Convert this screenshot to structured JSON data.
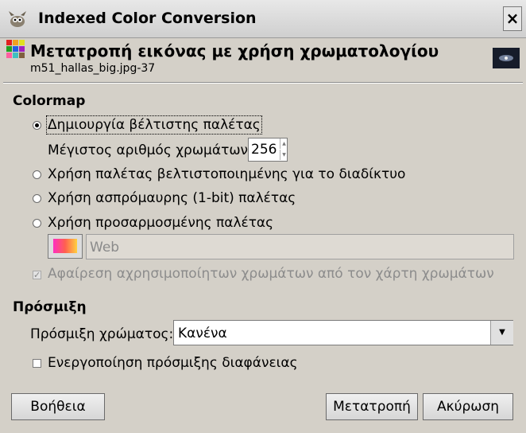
{
  "window": {
    "title": "Indexed Color Conversion",
    "close_label": "×"
  },
  "header": {
    "title": "Μετατροπή εικόνας με χρήση χρωματολογίου",
    "subtitle": "m51_hallas_big.jpg-37"
  },
  "colormap": {
    "heading": "Colormap",
    "opt_optimal": "Δημιουργία βέλτιστης παλέτας",
    "max_colors_label": "Μέγιστος αριθμός χρωμάτων:",
    "max_colors_value": "256",
    "opt_web": "Χρήση παλέτας βελτιστοποιημένης για το διαδίκτυο",
    "opt_bw": "Χρήση ασπρόμαυρης (1-bit) παλέτας",
    "opt_custom": "Χρήση προσαρμοσμένης παλέτας",
    "custom_palette": "Web",
    "remove_unused": "Αφαίρεση αχρησιμοποίητων χρωμάτων από τον χάρτη χρωμάτων",
    "selected": "optimal"
  },
  "dithering": {
    "heading": "Πρόσμιξη",
    "color_dither_label": "Πρόσμιξη χρώματος:",
    "color_dither_value": "Κανένα",
    "transparency_label": "Ενεργοποίηση πρόσμιξης διαφάνειας"
  },
  "buttons": {
    "help": "Βοήθεια",
    "convert": "Μετατροπή",
    "cancel": "Ακύρωση"
  },
  "colors": {
    "dialog_bg": "#d4d0c8",
    "title_bg": "#dcdcdc"
  }
}
